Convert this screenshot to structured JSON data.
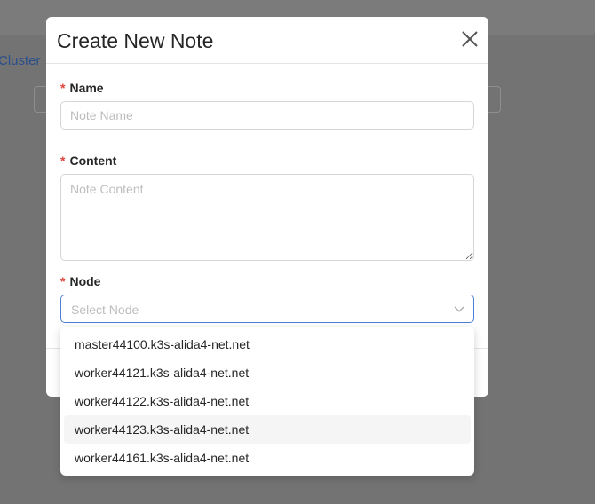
{
  "background": {
    "breadcrumb": "Cluster"
  },
  "modal": {
    "title": "Create New Note",
    "fields": {
      "name": {
        "label": "Name",
        "placeholder": "Note Name",
        "required_mark": "*"
      },
      "content": {
        "label": "Content",
        "placeholder": "Note Content",
        "required_mark": "*"
      },
      "node": {
        "label": "Node",
        "placeholder": "Select Node",
        "required_mark": "*"
      }
    }
  },
  "dropdown": {
    "options": [
      {
        "label": "master44100.k3s-alida4-net.net"
      },
      {
        "label": "worker44121.k3s-alida4-net.net"
      },
      {
        "label": "worker44122.k3s-alida4-net.net"
      },
      {
        "label": "worker44123.k3s-alida4-net.net"
      },
      {
        "label": "worker44161.k3s-alida4-net.net"
      }
    ],
    "highlighted_index": 3
  },
  "colors": {
    "required": "#e0443c",
    "focus_border": "#4b7fd6",
    "overlay": "#737373"
  },
  "icons": {
    "close": "close-icon",
    "chevron": "chevron-down-icon"
  }
}
